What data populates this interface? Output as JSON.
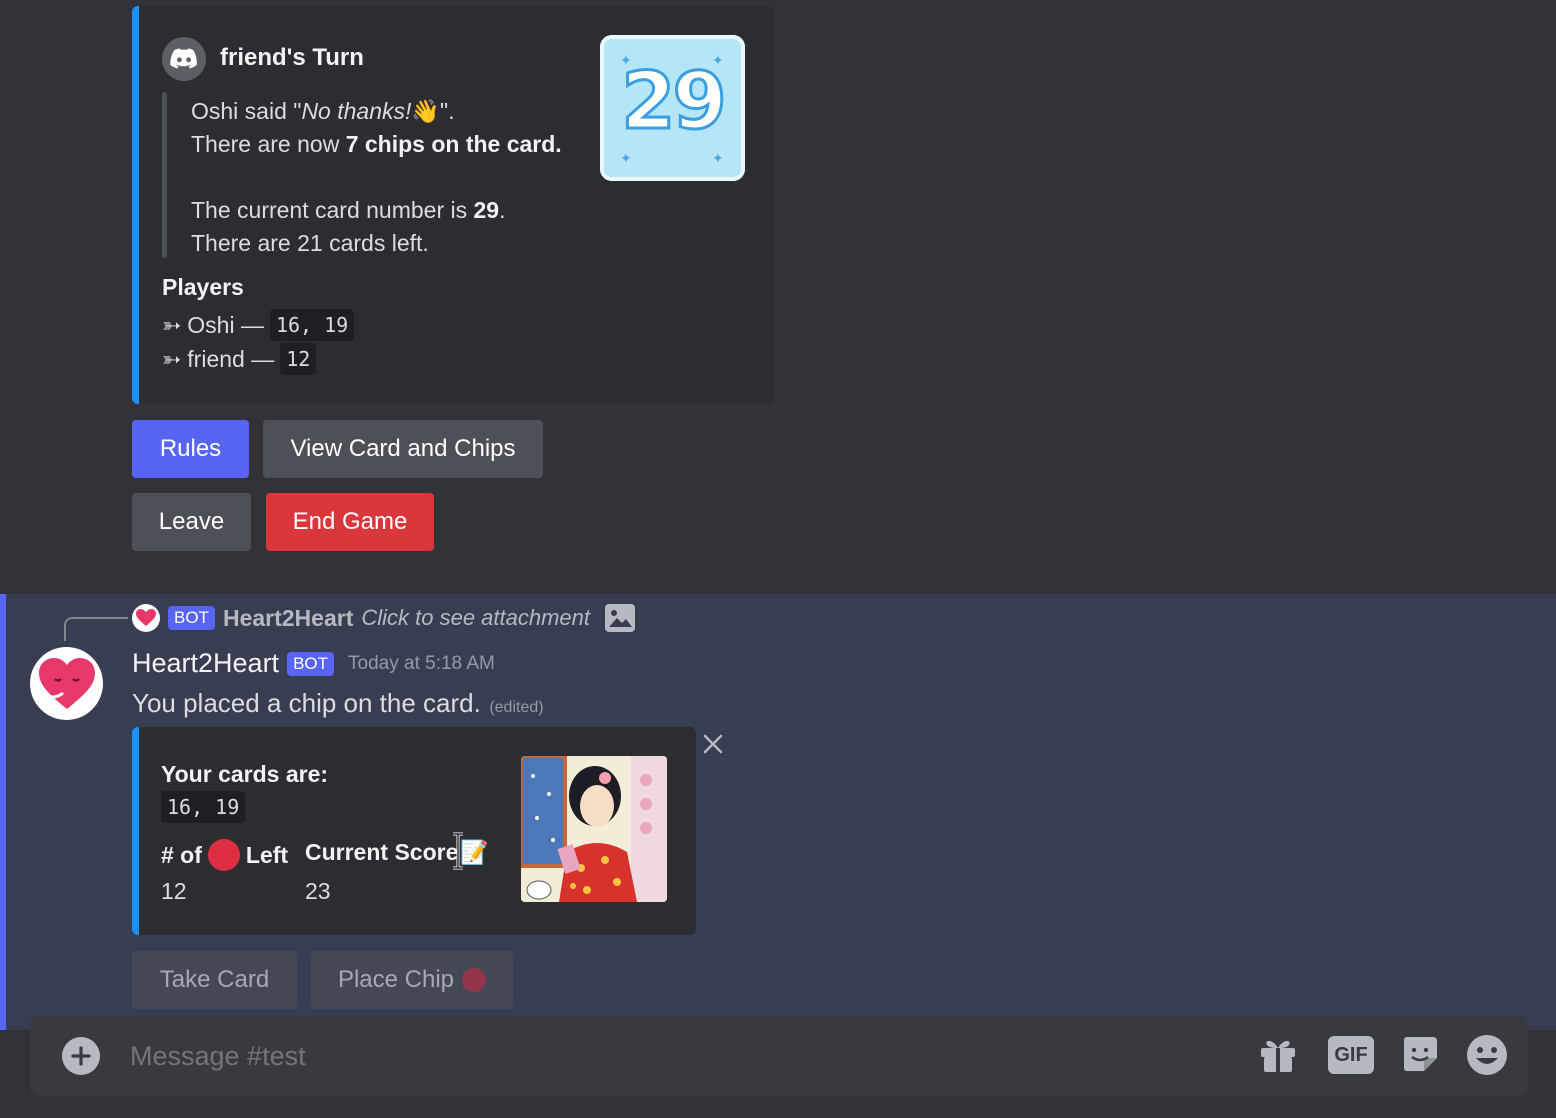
{
  "embed1": {
    "author": "friend's Turn",
    "line1_prefix": "Oshi said \"",
    "line1_italic": "No thanks!",
    "line1_emoji": "👋",
    "line1_suffix": "\".",
    "line2_prefix": "There are now ",
    "line2_bold": "7 chips on the card.",
    "line3_prefix": "The current card number is ",
    "line3_bold": "29",
    "line3_suffix": ".",
    "line4": "There are 21 cards left.",
    "players_title": "Players",
    "players": [
      {
        "arrow": "➳",
        "name": "Oshi —",
        "cards": "16, 19"
      },
      {
        "arrow": "➳",
        "name": "friend —",
        "cards": "12"
      }
    ],
    "thumbnail_text": "29"
  },
  "buttons_top": {
    "rules": "Rules",
    "view": "View Card and Chips",
    "leave": "Leave",
    "end": "End Game"
  },
  "reply": {
    "bot_tag": "BOT",
    "author": "Heart2Heart",
    "preview": "Click to see attachment"
  },
  "message": {
    "author": "Heart2Heart",
    "bot_tag": "BOT",
    "timestamp": "Today at 5:18 AM",
    "content": "You placed a chip on the card.",
    "edited": "(edited)"
  },
  "embed2": {
    "title": "Your cards are:",
    "cards": "16, 19",
    "field1_prefix": "# of",
    "field1_suffix": "Left",
    "field1_value": "12",
    "field2_name": "Current Score",
    "field2_emoji": "📝",
    "field2_value": "23"
  },
  "buttons_bottom": {
    "take": "Take Card",
    "place": "Place Chip"
  },
  "input": {
    "placeholder": "Message #test",
    "gif_label": "GIF"
  },
  "colors": {
    "blurple": "#5865f2",
    "danger": "#da373c",
    "embed_accent": "#1e8ff5",
    "background": "#313338"
  }
}
